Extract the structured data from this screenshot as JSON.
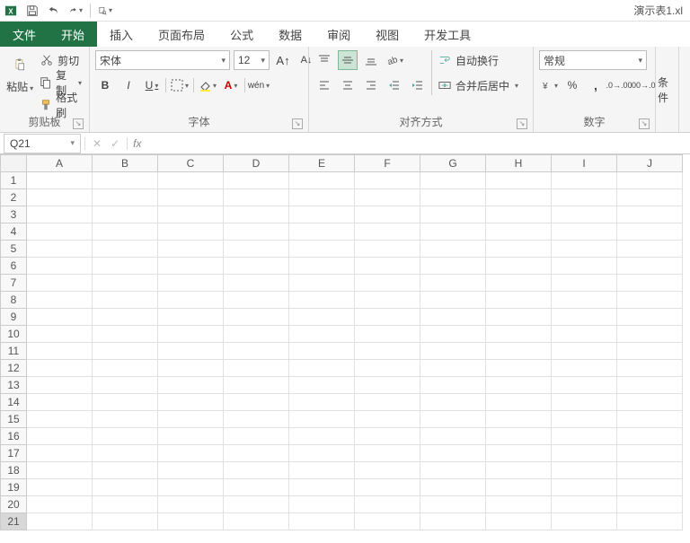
{
  "titlebar": {
    "file_title": "演示表1.xl"
  },
  "tabs": {
    "file": "文件",
    "items": [
      "开始",
      "插入",
      "页面布局",
      "公式",
      "数据",
      "审阅",
      "视图",
      "开发工具"
    ],
    "active_index": 0
  },
  "ribbon": {
    "clipboard": {
      "paste": "粘贴",
      "cut": "剪切",
      "copy": "复制",
      "format_painter": "格式刷",
      "group_label": "剪贴板"
    },
    "font": {
      "font_name": "宋体",
      "font_size": "12",
      "bold_tip": "B",
      "italic_tip": "I",
      "underline_tip": "U",
      "pinyin": "wén",
      "group_label": "字体"
    },
    "alignment": {
      "wrap": "自动换行",
      "merge": "合并后居中",
      "group_label": "对齐方式"
    },
    "number": {
      "format": "常规",
      "group_label": "数字"
    },
    "styles": {
      "conditional": "条件"
    }
  },
  "formula_bar": {
    "cell_ref": "Q21",
    "fx": "fx",
    "value": ""
  },
  "grid": {
    "columns": [
      "A",
      "B",
      "C",
      "D",
      "E",
      "F",
      "G",
      "H",
      "I",
      "J"
    ],
    "rows": [
      "1",
      "2",
      "3",
      "4",
      "5",
      "6",
      "7",
      "8",
      "9",
      "10",
      "11",
      "12",
      "13",
      "14",
      "15",
      "16",
      "17",
      "18",
      "19",
      "20",
      "21"
    ],
    "active_row_index": 20
  }
}
